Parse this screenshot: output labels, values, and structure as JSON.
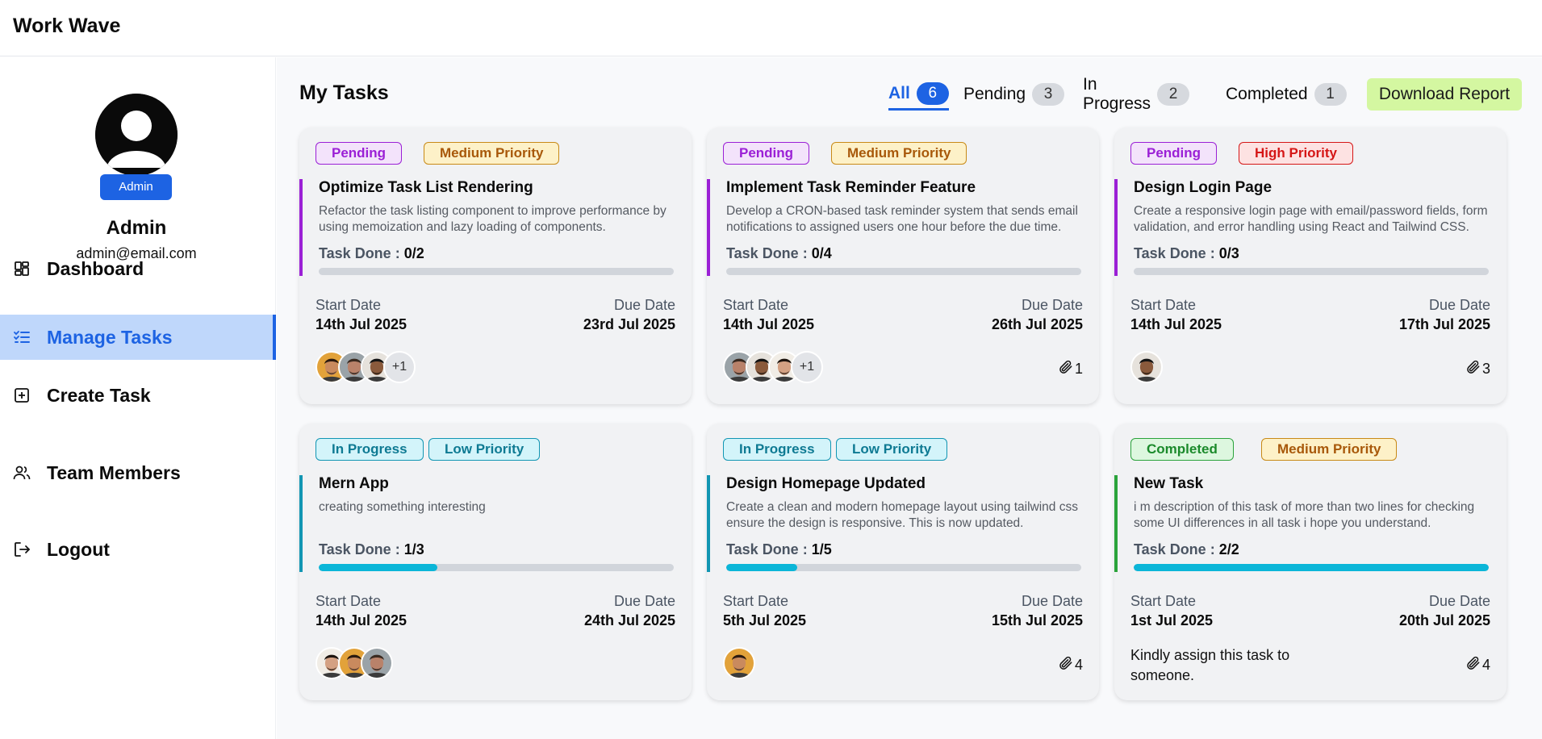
{
  "app": {
    "title": "Work Wave"
  },
  "user": {
    "role": "Admin",
    "name": "Admin",
    "email": "admin@email.com"
  },
  "menu": [
    {
      "label": "Dashboard",
      "icon": "dashboard-icon",
      "active": false
    },
    {
      "label": "Manage Tasks",
      "icon": "tasks-list-icon",
      "active": true
    },
    {
      "label": "Create Task",
      "icon": "plus-square-icon",
      "active": false
    },
    {
      "label": "Team Members",
      "icon": "users-icon",
      "active": false
    },
    {
      "label": "Logout",
      "icon": "logout-icon",
      "active": false
    }
  ],
  "page": {
    "title": "My Tasks"
  },
  "tabs": [
    {
      "label": "All",
      "count": "6",
      "active": true
    },
    {
      "label": "Pending",
      "count": "3",
      "active": false
    },
    {
      "label": "In Progress",
      "count": "2",
      "active": false
    },
    {
      "label": "Completed",
      "count": "1",
      "active": false
    }
  ],
  "download_label": "Download Report",
  "colors": {
    "accent": "#1d63e3",
    "pending": "#9b20d6",
    "in_progress": "#1296b3",
    "completed": "#2aa33b",
    "download_bg": "#d4f7a1"
  },
  "labels": {
    "task_done": "Task Done :",
    "start_date": "Start Date",
    "due_date": "Due Date"
  },
  "tasks": [
    {
      "status": "Pending",
      "priority": "Medium Priority",
      "title": "Optimize Task List Rendering",
      "description": "Refactor the task listing component to improve performance by using memoization and lazy loading of components.",
      "task_done": "0/2",
      "progress": 0,
      "start_date": "14th Jul 2025",
      "due_date": "23rd Jul 2025",
      "extra_assignees": "+1",
      "attachments": ""
    },
    {
      "status": "Pending",
      "priority": "Medium Priority",
      "title": "Implement Task Reminder Feature",
      "description": "Develop a CRON-based task reminder system that sends email notifications to assigned users one hour before the due time.",
      "task_done": "0/4",
      "progress": 0,
      "start_date": "14th Jul 2025",
      "due_date": "26th Jul 2025",
      "extra_assignees": "+1",
      "attachments": "1"
    },
    {
      "status": "Pending",
      "priority": "High Priority",
      "title": "Design Login Page",
      "description": "Create a responsive login page with email/password fields, form validation, and error handling using React and Tailwind CSS.",
      "task_done": "0/3",
      "progress": 0,
      "start_date": "14th Jul 2025",
      "due_date": "17th Jul 2025",
      "extra_assignees": "",
      "attachments": "3"
    },
    {
      "status": "In Progress",
      "priority": "Low Priority",
      "title": "Mern App",
      "description": "creating something interesting",
      "task_done": "1/3",
      "progress": 0.333,
      "start_date": "14th Jul 2025",
      "due_date": "24th Jul 2025",
      "extra_assignees": "",
      "attachments": ""
    },
    {
      "status": "In Progress",
      "priority": "Low Priority",
      "title": "Design Homepage Updated",
      "description": "Create a clean and modern homepage layout using tailwind css ensure the design is responsive. This is now updated.",
      "task_done": "1/5",
      "progress": 0.2,
      "start_date": "5th Jul 2025",
      "due_date": "15th Jul 2025",
      "extra_assignees": "",
      "attachments": "4"
    },
    {
      "status": "Completed",
      "priority": "Medium Priority",
      "title": "New Task",
      "description": "i m description of this task of more than two lines for checking some UI differences in all task i hope you understand.",
      "task_done": "2/2",
      "progress": 1,
      "start_date": "1st Jul 2025",
      "due_date": "20th Jul 2025",
      "extra_assignees": "",
      "attachments": "4",
      "note": "Kindly assign this task to someone."
    }
  ]
}
